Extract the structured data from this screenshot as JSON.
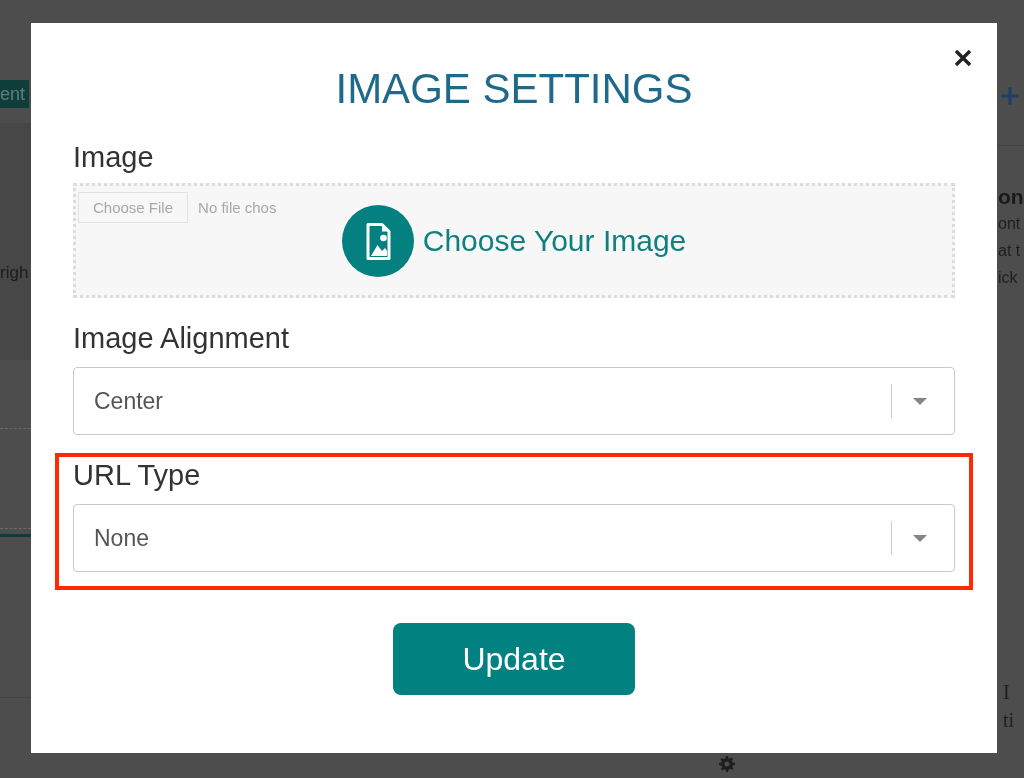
{
  "background_page": {
    "left_edge": {
      "badge": "ent",
      "text": "righ"
    },
    "right_edge": {
      "heading": "on",
      "lines": [
        "ont",
        "at t",
        "ick"
      ],
      "serif_lines": [
        "I",
        "ti"
      ]
    }
  },
  "dialog": {
    "title": "IMAGE SETTINGS",
    "fields": [
      {
        "kind": "upload",
        "label": "Image",
        "file_button": "Choose File",
        "file_status": "No file chos",
        "prompt": "Choose Your Image",
        "highlighted": false
      },
      {
        "kind": "select",
        "label": "Image Alignment",
        "value": "Center",
        "highlighted": false
      },
      {
        "kind": "select",
        "label": "URL Type",
        "value": "None",
        "highlighted": true
      }
    ],
    "submit": "Update"
  }
}
